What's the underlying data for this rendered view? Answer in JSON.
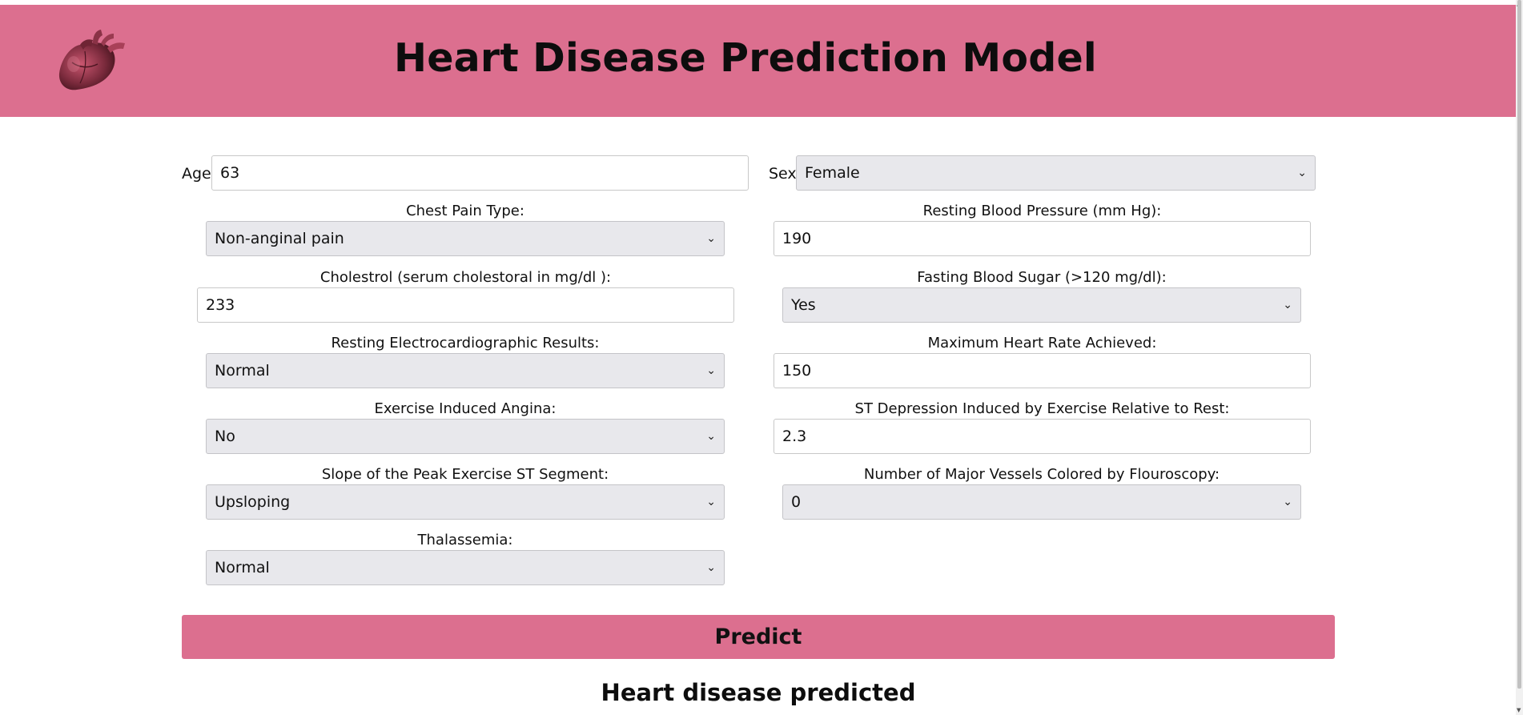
{
  "header": {
    "title": "Heart Disease Prediction Model",
    "logo_icon": "anatomical-heart-icon"
  },
  "form": {
    "age": {
      "label": "Age:",
      "value": "63"
    },
    "sex": {
      "label": "Sex:",
      "value": "Female"
    },
    "chest_pain": {
      "label": "Chest Pain Type:",
      "value": "Non-anginal pain"
    },
    "resting_bp": {
      "label": "Resting Blood Pressure (mm Hg):",
      "value": "190"
    },
    "cholesterol": {
      "label": "Cholestrol (serum cholestoral in mg/dl ):",
      "value": "233"
    },
    "fasting_sugar": {
      "label": "Fasting Blood Sugar (>120 mg/dl):",
      "value": "Yes"
    },
    "resting_ecg": {
      "label": "Resting Electrocardiographic Results:",
      "value": "Normal"
    },
    "max_heart_rate": {
      "label": "Maximum Heart Rate Achieved:",
      "value": "150"
    },
    "exercise_angina": {
      "label": "Exercise Induced Angina:",
      "value": "No"
    },
    "st_depression": {
      "label": "ST Depression Induced by Exercise Relative to Rest:",
      "value": "2.3"
    },
    "slope": {
      "label": "Slope of the Peak Exercise ST Segment:",
      "value": "Upsloping"
    },
    "major_vessels": {
      "label": "Number of Major Vessels Colored by Flouroscopy:",
      "value": "0"
    },
    "thalassemia": {
      "label": "Thalassemia:",
      "value": "Normal"
    }
  },
  "predict_button": {
    "label": "Predict"
  },
  "result": {
    "text": "Heart disease predicted"
  },
  "colors": {
    "header_bg": "#dc6f8f",
    "button_bg": "#dc6f8f",
    "select_bg": "#e8e8ec"
  }
}
